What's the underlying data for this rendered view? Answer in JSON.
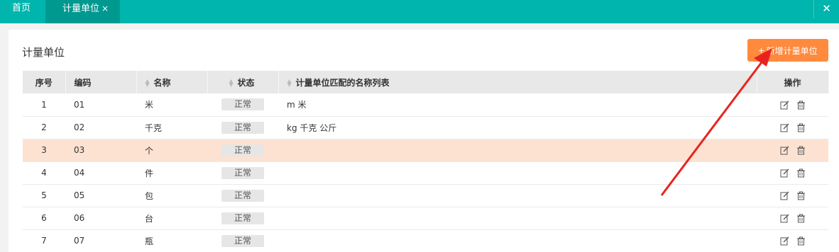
{
  "tabs": {
    "home": "首页",
    "active": "计量单位",
    "active_close": "×",
    "window_close": "✕"
  },
  "card": {
    "title": "计量单位",
    "add_button": "新增计量单位",
    "add_icon": "+"
  },
  "table": {
    "headers": {
      "index": "序号",
      "code": "编码",
      "name": "名称",
      "status": "状态",
      "match_names": "计量单位匹配的名称列表",
      "actions": "操作"
    },
    "rows": [
      {
        "index": "1",
        "code": "01",
        "name": "米",
        "status": "正常",
        "match_names": "m 米"
      },
      {
        "index": "2",
        "code": "02",
        "name": "千克",
        "status": "正常",
        "match_names": "kg 千克 公斤"
      },
      {
        "index": "3",
        "code": "03",
        "name": "个",
        "status": "正常",
        "match_names": ""
      },
      {
        "index": "4",
        "code": "04",
        "name": "件",
        "status": "正常",
        "match_names": ""
      },
      {
        "index": "5",
        "code": "05",
        "name": "包",
        "status": "正常",
        "match_names": ""
      },
      {
        "index": "6",
        "code": "06",
        "name": "台",
        "status": "正常",
        "match_names": ""
      },
      {
        "index": "7",
        "code": "07",
        "name": "瓶",
        "status": "正常",
        "match_names": ""
      }
    ],
    "highlighted_row": 3
  },
  "colors": {
    "topbar": "#00b5ad",
    "active_tab": "#009990",
    "accent_button": "#ff8a3d",
    "highlight_row": "#fde2d2",
    "annotation_arrow": "#e8231f"
  }
}
